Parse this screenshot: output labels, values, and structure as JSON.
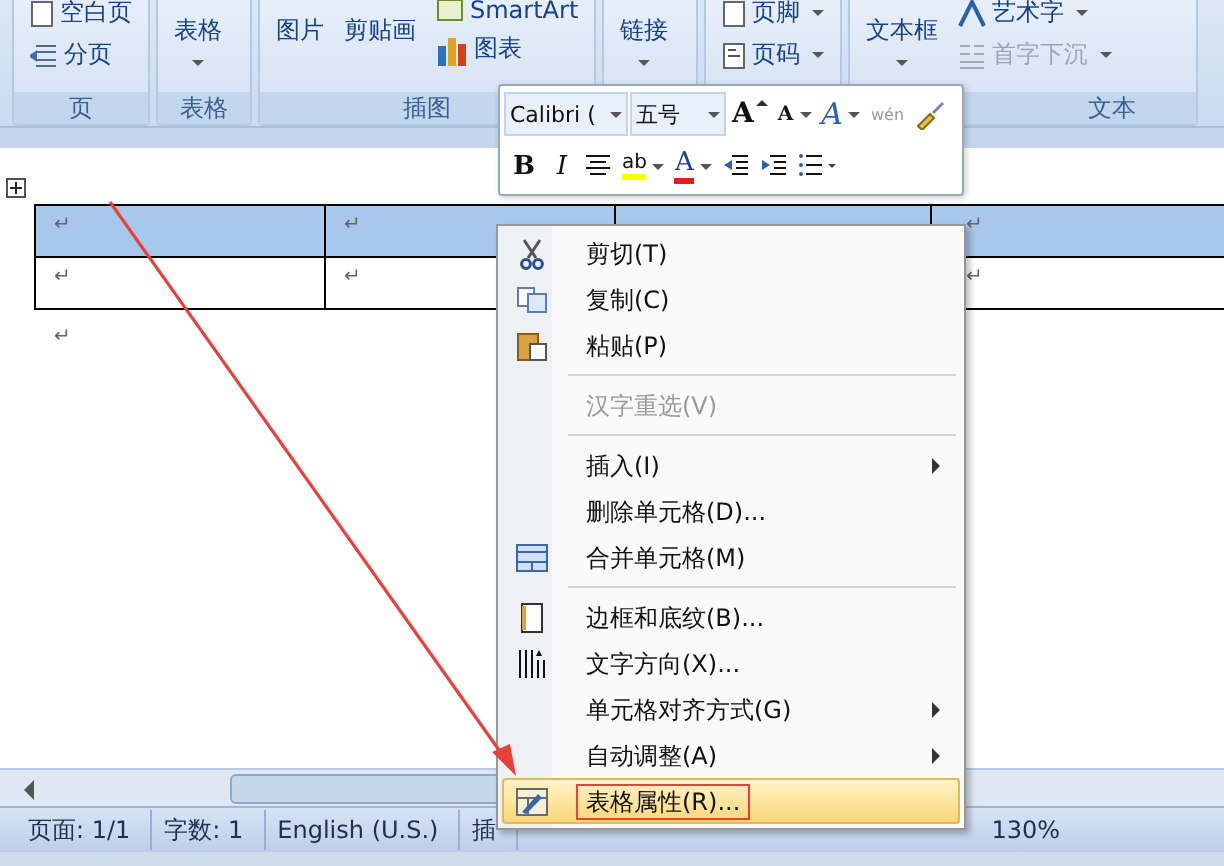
{
  "ribbon": {
    "groups": [
      {
        "label": "页",
        "items": [
          {
            "kind": "blankpage",
            "label": "空白页",
            "dropdown": false,
            "disabled": false
          },
          {
            "kind": "pagebreak",
            "label": "分页",
            "dropdown": false,
            "disabled": false
          }
        ]
      },
      {
        "label": "表格",
        "items": [
          {
            "kind": "large",
            "label": "表格",
            "dropdown": true,
            "disabled": false
          }
        ]
      },
      {
        "label": "插图",
        "items": [
          {
            "kind": "large",
            "label": "图片",
            "dropdown": false,
            "disabled": false
          },
          {
            "kind": "large",
            "label": "剪贴画",
            "dropdown": false,
            "disabled": false
          },
          {
            "kind": "smartart",
            "label": "SmartArt",
            "dropdown": false,
            "disabled": false
          },
          {
            "kind": "chart",
            "label": "图表",
            "dropdown": false,
            "disabled": false
          }
        ]
      },
      {
        "items": [
          {
            "kind": "large",
            "label": "链接",
            "dropdown": true,
            "disabled": false
          }
        ]
      },
      {
        "items": [
          {
            "kind": "footer",
            "label": "页脚",
            "dropdown": true,
            "disabled": false
          },
          {
            "kind": "pagenumber",
            "label": "页码",
            "dropdown": true,
            "disabled": false
          }
        ]
      },
      {
        "label": "文本",
        "items": [
          {
            "kind": "large",
            "label": "文本框",
            "dropdown": true,
            "disabled": false
          },
          {
            "kind": "wordart",
            "label": "艺术字",
            "dropdown": true,
            "disabled": false
          },
          {
            "kind": "dropcap",
            "label": "首字下沉",
            "dropdown": true,
            "disabled": true
          }
        ]
      }
    ]
  },
  "mini_toolbar": {
    "font": "Calibri (",
    "size": "五号",
    "row_1": [
      {
        "kind": "grow",
        "glyph": "A"
      },
      {
        "kind": "shrink",
        "glyph": "A"
      },
      {
        "kind": "effect",
        "glyph": "A"
      },
      {
        "kind": "phonetic",
        "glyph": "wén"
      },
      {
        "kind": "painter"
      }
    ],
    "row_2": [
      {
        "kind": "bold",
        "glyph": "B"
      },
      {
        "kind": "italic",
        "glyph": "I"
      },
      {
        "kind": "center"
      },
      {
        "kind": "highlight",
        "glyph": "ab"
      },
      {
        "kind": "fontcolor",
        "glyph": "A"
      },
      {
        "kind": "outdent"
      },
      {
        "kind": "indent"
      },
      {
        "kind": "bullets"
      }
    ]
  },
  "document": {
    "table": {
      "rows": [
        {
          "selected": true,
          "cells": [
            "↵",
            "↵",
            "",
            "↵"
          ]
        },
        {
          "selected": false,
          "cells": [
            "↵",
            "↵",
            "",
            "↵"
          ]
        }
      ]
    },
    "paragraph_mark": "↵"
  },
  "context_menu": {
    "items": [
      {
        "kind": "cut",
        "label": "剪切(T)",
        "submenu": false,
        "disabled": false,
        "selected": false
      },
      {
        "kind": "copy",
        "label": "复制(C)",
        "submenu": false,
        "disabled": false,
        "selected": false
      },
      {
        "kind": "paste",
        "label": "粘贴(P)",
        "submenu": false,
        "disabled": false,
        "selected": false
      },
      {
        "kind": "separator"
      },
      {
        "kind": "plain",
        "label": "汉字重选(V)",
        "submenu": false,
        "disabled": true,
        "selected": false
      },
      {
        "kind": "separator"
      },
      {
        "kind": "plain",
        "label": "插入(I)",
        "submenu": true,
        "disabled": false,
        "selected": false
      },
      {
        "kind": "plain",
        "label": "删除单元格(D)...",
        "submenu": false,
        "disabled": false,
        "selected": false
      },
      {
        "kind": "merge",
        "label": "合并单元格(M)",
        "submenu": false,
        "disabled": false,
        "selected": false
      },
      {
        "kind": "separator"
      },
      {
        "kind": "borders",
        "label": "边框和底纹(B)...",
        "submenu": false,
        "disabled": false,
        "selected": false
      },
      {
        "kind": "direction",
        "label": "文字方向(X)...",
        "submenu": false,
        "disabled": false,
        "selected": false
      },
      {
        "kind": "plain",
        "label": "单元格对齐方式(G)",
        "submenu": true,
        "disabled": false,
        "selected": false
      },
      {
        "kind": "plain",
        "label": "自动调整(A)",
        "submenu": true,
        "disabled": false,
        "selected": false
      },
      {
        "kind": "properties",
        "label": "表格属性(R)...",
        "submenu": false,
        "disabled": false,
        "selected": true
      }
    ]
  },
  "status_bar": {
    "items": [
      "页面: 1/1",
      "字数: 1",
      "English (U.S.)",
      "插"
    ],
    "zoom": "130%"
  }
}
